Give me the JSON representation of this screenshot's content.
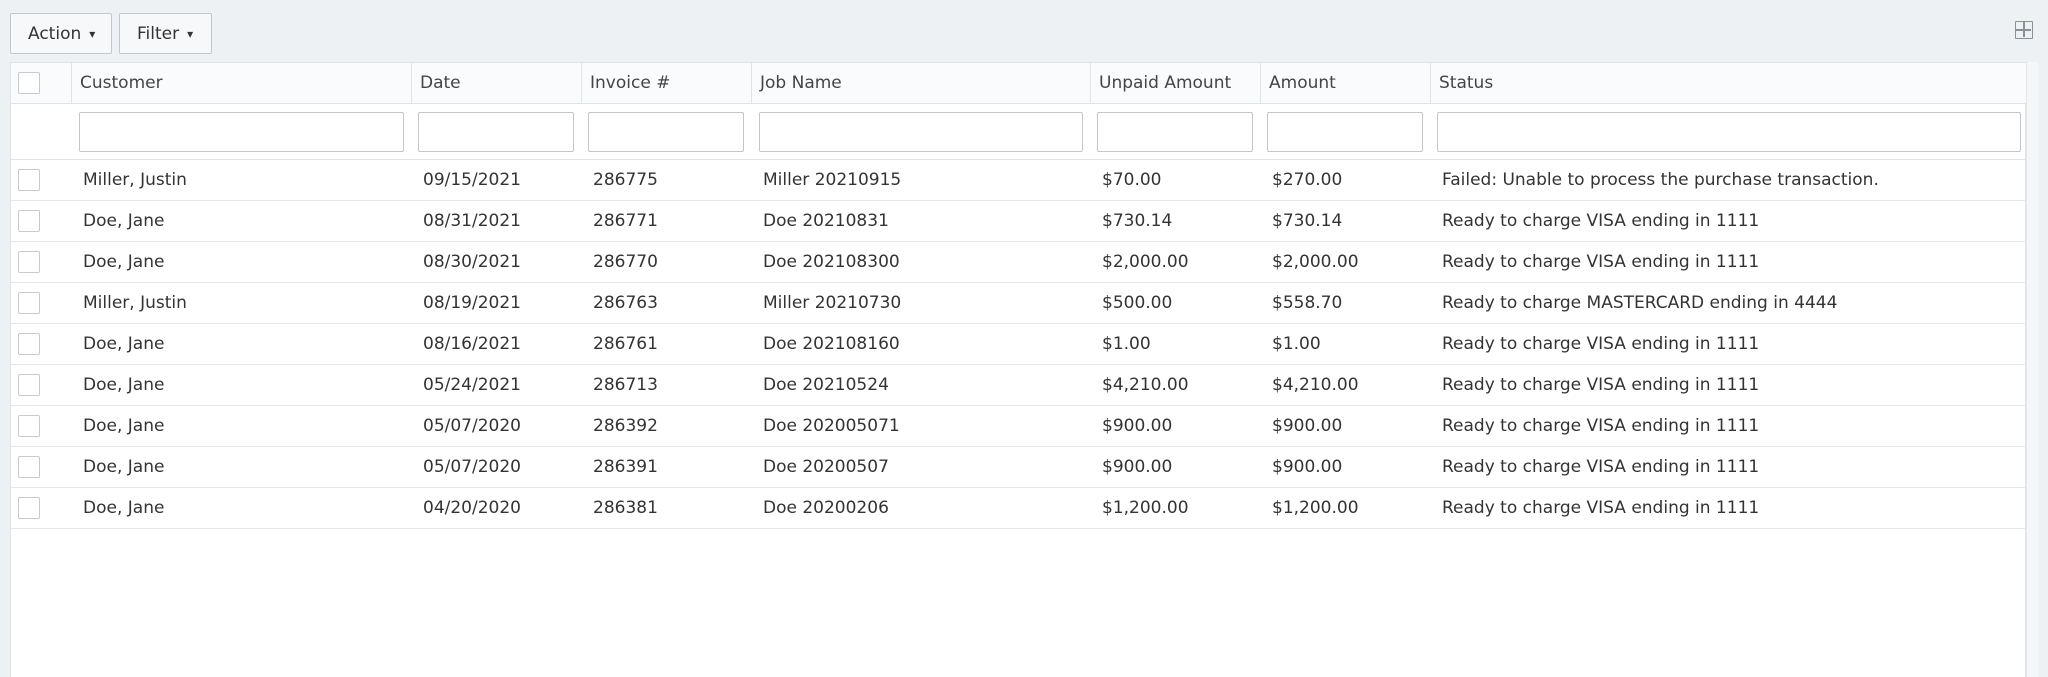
{
  "toolbar": {
    "action_label": "Action",
    "filter_label": "Filter",
    "caret": "▾",
    "grid_icon": "grid-layout-icon"
  },
  "table": {
    "columns": [
      "Customer",
      "Date",
      "Invoice #",
      "Job Name",
      "Unpaid Amount",
      "Amount",
      "Status"
    ],
    "filters": [
      "",
      "",
      "",
      "",
      "",
      "",
      ""
    ],
    "rows": [
      {
        "customer": "Miller, Justin",
        "date": "09/15/2021",
        "invoice": "286775",
        "job": "Miller 20210915",
        "unpaid": "$70.00",
        "amount": "$270.00",
        "status": "Failed: Unable to process the purchase transaction."
      },
      {
        "customer": "Doe, Jane",
        "date": "08/31/2021",
        "invoice": "286771",
        "job": "Doe 20210831",
        "unpaid": "$730.14",
        "amount": "$730.14",
        "status": "Ready to charge VISA ending in 1111"
      },
      {
        "customer": "Doe, Jane",
        "date": "08/30/2021",
        "invoice": "286770",
        "job": "Doe 202108300",
        "unpaid": "$2,000.00",
        "amount": "$2,000.00",
        "status": "Ready to charge VISA ending in 1111"
      },
      {
        "customer": "Miller, Justin",
        "date": "08/19/2021",
        "invoice": "286763",
        "job": "Miller 20210730",
        "unpaid": "$500.00",
        "amount": "$558.70",
        "status": "Ready to charge MASTERCARD ending in 4444"
      },
      {
        "customer": "Doe, Jane",
        "date": "08/16/2021",
        "invoice": "286761",
        "job": "Doe 202108160",
        "unpaid": "$1.00",
        "amount": "$1.00",
        "status": "Ready to charge VISA ending in 1111"
      },
      {
        "customer": "Doe, Jane",
        "date": "05/24/2021",
        "invoice": "286713",
        "job": "Doe 20210524",
        "unpaid": "$4,210.00",
        "amount": "$4,210.00",
        "status": "Ready to charge VISA ending in 1111"
      },
      {
        "customer": "Doe, Jane",
        "date": "05/07/2020",
        "invoice": "286392",
        "job": "Doe 202005071",
        "unpaid": "$900.00",
        "amount": "$900.00",
        "status": "Ready to charge VISA ending in 1111"
      },
      {
        "customer": "Doe, Jane",
        "date": "05/07/2020",
        "invoice": "286391",
        "job": "Doe 20200507",
        "unpaid": "$900.00",
        "amount": "$900.00",
        "status": "Ready to charge VISA ending in 1111"
      },
      {
        "customer": "Doe, Jane",
        "date": "04/20/2020",
        "invoice": "286381",
        "job": "Doe 20200206",
        "unpaid": "$1,200.00",
        "amount": "$1,200.00",
        "status": "Ready to charge VISA ending in 1111"
      }
    ]
  }
}
